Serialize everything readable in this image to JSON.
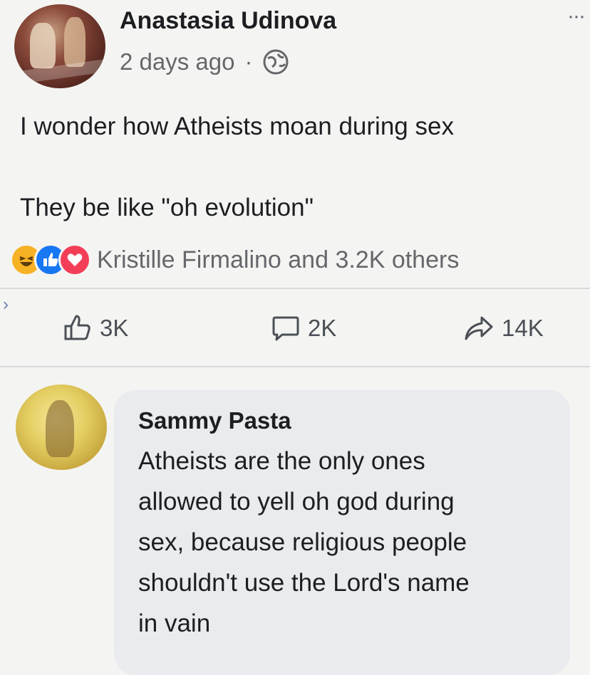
{
  "post": {
    "author": "Anastasia Udinova",
    "time": "2 days ago",
    "separator": "·",
    "privacy_icon": "globe-icon",
    "more_label": "···",
    "text_line1": "I wonder how Atheists moan during sex",
    "text_line2": "They be like \"oh evolution\""
  },
  "reactions": {
    "icons": [
      "haha-icon",
      "like-icon",
      "love-icon"
    ],
    "summary": "Kristille Firmalino and 3.2K others"
  },
  "actions": {
    "like_count": "3K",
    "comment_count": "2K",
    "share_count": "14K"
  },
  "comment": {
    "author": "Sammy Pasta",
    "lines": [
      "Atheists are the only ones",
      "allowed to yell oh god during",
      "sex, because religious people",
      "shouldn't use the Lord's name",
      "in vain"
    ]
  },
  "colors": {
    "like_blue": "#1877f2",
    "love_red": "#f33e58",
    "haha_yellow": "#f7b125",
    "secondary_text": "#65676b"
  }
}
